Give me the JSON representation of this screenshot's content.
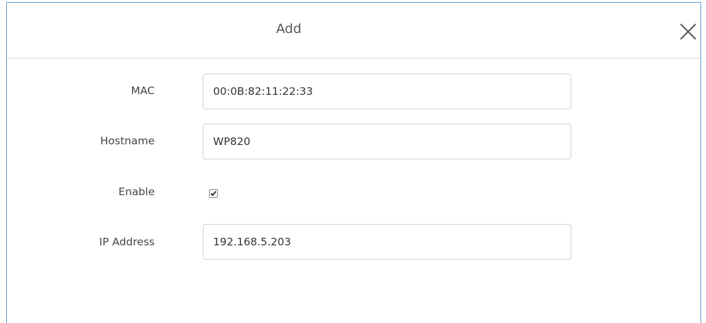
{
  "dialog": {
    "title": "Add",
    "close_icon": "close-icon"
  },
  "form": {
    "mac": {
      "label": "MAC",
      "value": "00:0B:82:11:22:33"
    },
    "hostname": {
      "label": "Hostname",
      "value": "WP820"
    },
    "enable": {
      "label": "Enable",
      "checked": true,
      "icon": "checkmark-icon"
    },
    "ip_address": {
      "label": "IP Address",
      "value": "192.168.5.203"
    }
  },
  "colors": {
    "dialog_border": "#5b9bd5",
    "field_border": "#cfcfcf",
    "label_text": "#444444"
  }
}
